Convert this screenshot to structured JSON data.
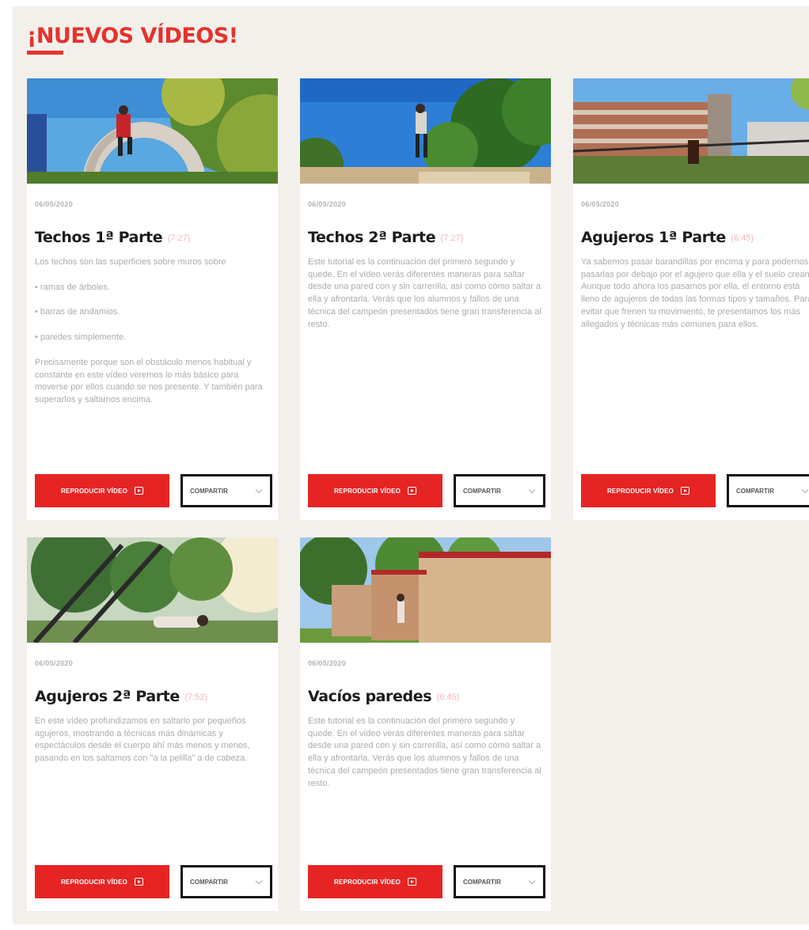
{
  "section": {
    "title": "¡NUEVOS VÍDEOS!"
  },
  "cards": [
    {
      "date": "06/05/2020",
      "title": "Techos 1ª Parte",
      "duration": "(7:27)",
      "paragraphs": [
        "Los techos son las superficies sobre muros sobre"
      ],
      "list": [
        "• ramas de árboles.",
        "• barras de andamios.",
        "• paredes simplemente."
      ],
      "paragraphs_after": [
        "Precisamente porque son el obstáculo menos habitual y constante en este vídeo veremos lo más básico para moverse por ellos cuando se nos presente. Y también para superarlos y saltarnos encima."
      ],
      "play_label": "Reproducir vídeo",
      "share_label": "Compartir"
    },
    {
      "date": "06/05/2020",
      "title": "Techos 2ª Parte",
      "duration": "(7:27)",
      "paragraphs": [
        "Este tutorial es la continuación del primero segundo y quede. En el vídeo verás diferentes maneras para saltar desde una pared con y sin carrerilla, así como cómo saltar a ella y afrontarla. Verás que los alumnos y fallos de una técnica del campeón presentados tiene gran transferencia al resto."
      ],
      "list": [],
      "paragraphs_after": [],
      "play_label": "Reproducir vídeo",
      "share_label": "Compartir"
    },
    {
      "date": "06/05/2020",
      "title": "Agujeros 1ª Parte",
      "duration": "(6:45)",
      "paragraphs": [
        "Ya sabemos pasar barandillas por encima y para podernos pasarlas por debajo por el agujero que ella y el suelo crean. Aunque todo ahora los pasamos por ella, el entorno está lleno de agujeros de todas las formas tipos y tamaños. Para evitar que frenen tu movimiento, te presentamos los más allegados y técnicas más comunes para ellos."
      ],
      "list": [],
      "paragraphs_after": [],
      "play_label": "Reproducir vídeo",
      "share_label": "Compartir"
    },
    {
      "date": "06/05/2020",
      "title": "Agujeros 2ª Parte",
      "duration": "(7:52)",
      "paragraphs": [
        "En este vídeo profundizamos en saltarlo por pequeños agujeros, mostrando a técnicas más dinámicas y espectáculos desde el cuerpo ahí más menos y menos, pasando en los saltamos con \"a la pelilla\" a de cabeza."
      ],
      "list": [],
      "paragraphs_after": [],
      "play_label": "Reproducir vídeo",
      "share_label": "Compartir"
    },
    {
      "date": "06/05/2020",
      "title": "Vacíos paredes",
      "duration": "(6:45)",
      "paragraphs": [
        "Este tutorial es la continuación del primero segundo y quede. En el vídeo verás diferentes maneras para saltar desde una pared con y sin carrerilla, así como cómo saltar a ella y afrontarla. Verás que los alumnos y fallos de una técnica del campeón presentados tiene gran transferencia al resto."
      ],
      "list": [],
      "paragraphs_after": [],
      "play_label": "Reproducir vídeo",
      "share_label": "Compartir"
    }
  ],
  "colors": {
    "accent": "#e62424",
    "title": "#e5322d",
    "background": "#f3f0eb"
  }
}
